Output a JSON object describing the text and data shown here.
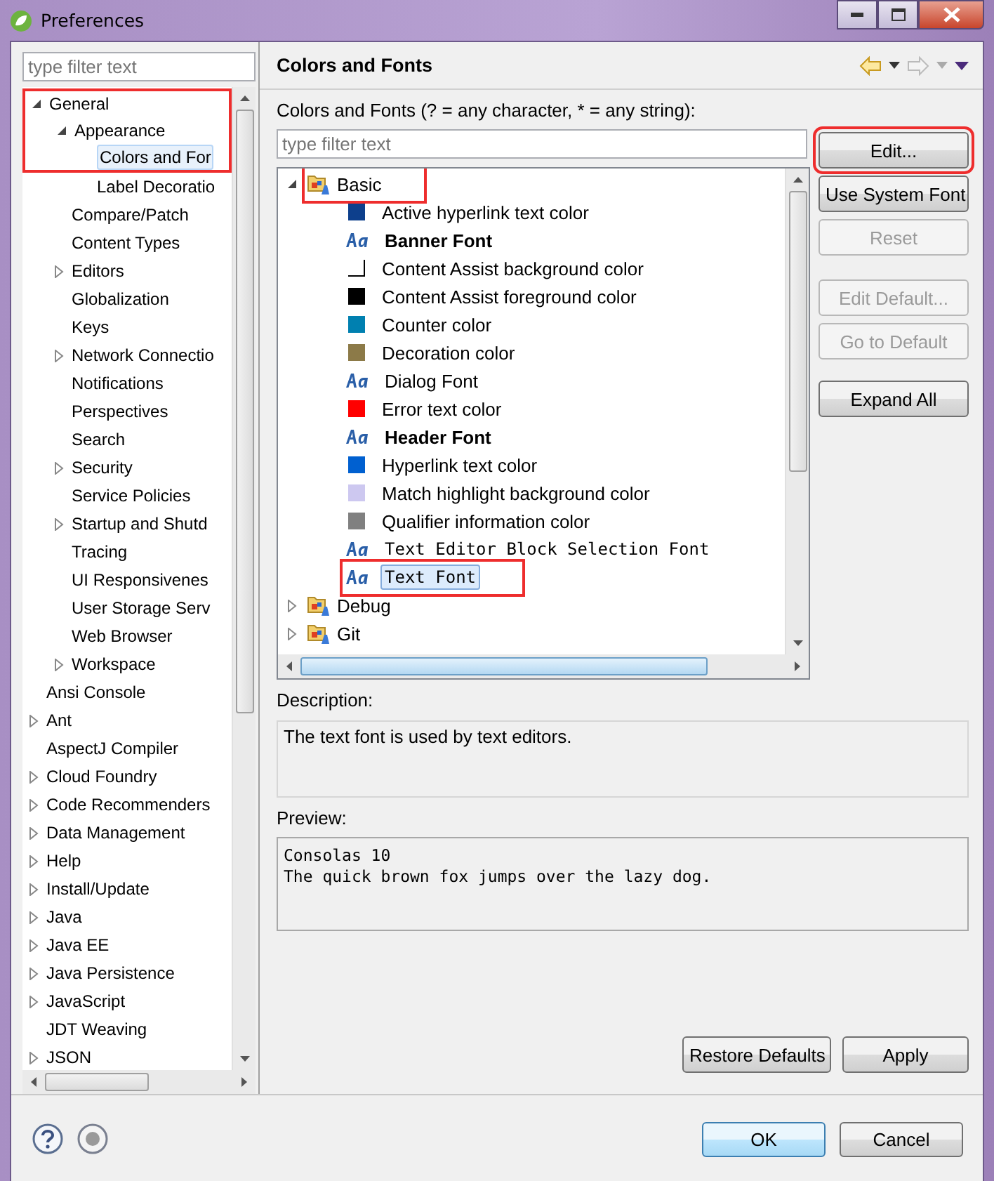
{
  "window": {
    "title": "Preferences"
  },
  "sidebar": {
    "filter": {
      "placeholder": "type filter text"
    },
    "items": [
      {
        "label": "General",
        "kind": "branch",
        "expanded": true,
        "selected": false,
        "marked": true,
        "children": [
          {
            "label": "Appearance",
            "kind": "branch",
            "expanded": true,
            "selected": false,
            "marked": true,
            "children": [
              {
                "label": "Colors and For",
                "kind": "leaf",
                "selected": true,
                "marked": true
              },
              {
                "label": "Label Decoratio",
                "kind": "leaf",
                "selected": false
              }
            ]
          },
          {
            "label": "Compare/Patch",
            "kind": "leaf",
            "selected": false
          },
          {
            "label": "Content Types",
            "kind": "leaf",
            "selected": false
          },
          {
            "label": "Editors",
            "kind": "branch",
            "expanded": false,
            "selected": false
          },
          {
            "label": "Globalization",
            "kind": "leaf",
            "selected": false
          },
          {
            "label": "Keys",
            "kind": "leaf",
            "selected": false
          },
          {
            "label": "Network Connectio",
            "kind": "branch",
            "expanded": false,
            "selected": false
          },
          {
            "label": "Notifications",
            "kind": "leaf",
            "selected": false
          },
          {
            "label": "Perspectives",
            "kind": "leaf",
            "selected": false
          },
          {
            "label": "Search",
            "kind": "leaf",
            "selected": false
          },
          {
            "label": "Security",
            "kind": "branch",
            "expanded": false,
            "selected": false
          },
          {
            "label": "Service Policies",
            "kind": "leaf",
            "selected": false
          },
          {
            "label": "Startup and Shutd",
            "kind": "branch",
            "expanded": false,
            "selected": false
          },
          {
            "label": "Tracing",
            "kind": "leaf",
            "selected": false
          },
          {
            "label": "UI Responsivenes",
            "kind": "leaf",
            "selected": false
          },
          {
            "label": "User Storage Serv",
            "kind": "leaf",
            "selected": false
          },
          {
            "label": "Web Browser",
            "kind": "leaf",
            "selected": false
          },
          {
            "label": "Workspace",
            "kind": "branch",
            "expanded": false,
            "selected": false
          }
        ]
      },
      {
        "label": "Ansi Console",
        "kind": "leaf",
        "selected": false
      },
      {
        "label": "Ant",
        "kind": "branch",
        "expanded": false,
        "selected": false
      },
      {
        "label": "AspectJ Compiler",
        "kind": "leaf",
        "selected": false
      },
      {
        "label": "Cloud Foundry",
        "kind": "branch",
        "expanded": false,
        "selected": false
      },
      {
        "label": "Code Recommenders",
        "kind": "branch",
        "expanded": false,
        "selected": false
      },
      {
        "label": "Data Management",
        "kind": "branch",
        "expanded": false,
        "selected": false
      },
      {
        "label": "Help",
        "kind": "branch",
        "expanded": false,
        "selected": false
      },
      {
        "label": "Install/Update",
        "kind": "branch",
        "expanded": false,
        "selected": false
      },
      {
        "label": "Java",
        "kind": "branch",
        "expanded": false,
        "selected": false
      },
      {
        "label": "Java EE",
        "kind": "branch",
        "expanded": false,
        "selected": false
      },
      {
        "label": "Java Persistence",
        "kind": "branch",
        "expanded": false,
        "selected": false
      },
      {
        "label": "JavaScript",
        "kind": "branch",
        "expanded": false,
        "selected": false
      },
      {
        "label": "JDT Weaving",
        "kind": "leaf",
        "selected": false
      },
      {
        "label": "JSON",
        "kind": "branch",
        "expanded": false,
        "selected": false
      }
    ]
  },
  "page": {
    "title": "Colors and Fonts",
    "filter_label": "Colors and Fonts (? = any character, * = any string):",
    "filter": {
      "placeholder": "type filter text"
    },
    "tree": [
      {
        "label": "Basic",
        "expanded": true,
        "marked": true,
        "children": [
          {
            "label": "Active hyperlink text color",
            "kind": "color",
            "color": "#0d3f8c",
            "selected": false
          },
          {
            "label": "Banner Font",
            "kind": "bold-font",
            "selected": false
          },
          {
            "label": "Content Assist background color",
            "kind": "color",
            "color": "#ffffff",
            "selected": false
          },
          {
            "label": "Content Assist foreground color",
            "kind": "color",
            "color": "#000000",
            "selected": false
          },
          {
            "label": "Counter color",
            "kind": "color",
            "color": "#0080b0",
            "selected": false
          },
          {
            "label": "Decoration color",
            "kind": "color",
            "color": "#8c7a48",
            "selected": false
          },
          {
            "label": "Dialog Font",
            "kind": "font",
            "selected": false
          },
          {
            "label": "Error text color",
            "kind": "color",
            "color": "#ff0000",
            "selected": false
          },
          {
            "label": "Header Font",
            "kind": "bold-font",
            "selected": false
          },
          {
            "label": "Hyperlink text color",
            "kind": "color",
            "color": "#0060d0",
            "selected": false
          },
          {
            "label": "Match highlight background color",
            "kind": "color",
            "color": "#cdc8f0",
            "selected": false
          },
          {
            "label": "Qualifier information color",
            "kind": "color",
            "color": "#808080",
            "selected": false
          },
          {
            "label": "Text Editor Block Selection Font",
            "kind": "mono-font",
            "selected": false
          },
          {
            "label": "Text Font",
            "kind": "mono-font",
            "selected": true,
            "marked": true
          }
        ]
      },
      {
        "label": "Debug",
        "expanded": false
      },
      {
        "label": "Git",
        "expanded": false
      }
    ],
    "buttons": [
      {
        "label": "Edit...",
        "disabled": false,
        "marked": true
      },
      {
        "label": "Use System Font",
        "disabled": false
      },
      {
        "label": "Reset",
        "disabled": true
      },
      {
        "label": "Edit Default...",
        "disabled": true
      },
      {
        "label": "Go to Default",
        "disabled": true
      },
      {
        "label": "Expand All",
        "disabled": false
      }
    ],
    "description_label": "Description:",
    "description": "The text font is used by text editors.",
    "preview_label": "Preview:",
    "preview_lines": [
      "Consolas 10",
      "The quick brown fox jumps over the lazy dog."
    ],
    "actions": [
      "Restore Defaults",
      "Apply"
    ]
  },
  "footer": {
    "buttons": [
      {
        "label": "OK",
        "default": true
      },
      {
        "label": "Cancel",
        "default": false
      }
    ]
  }
}
